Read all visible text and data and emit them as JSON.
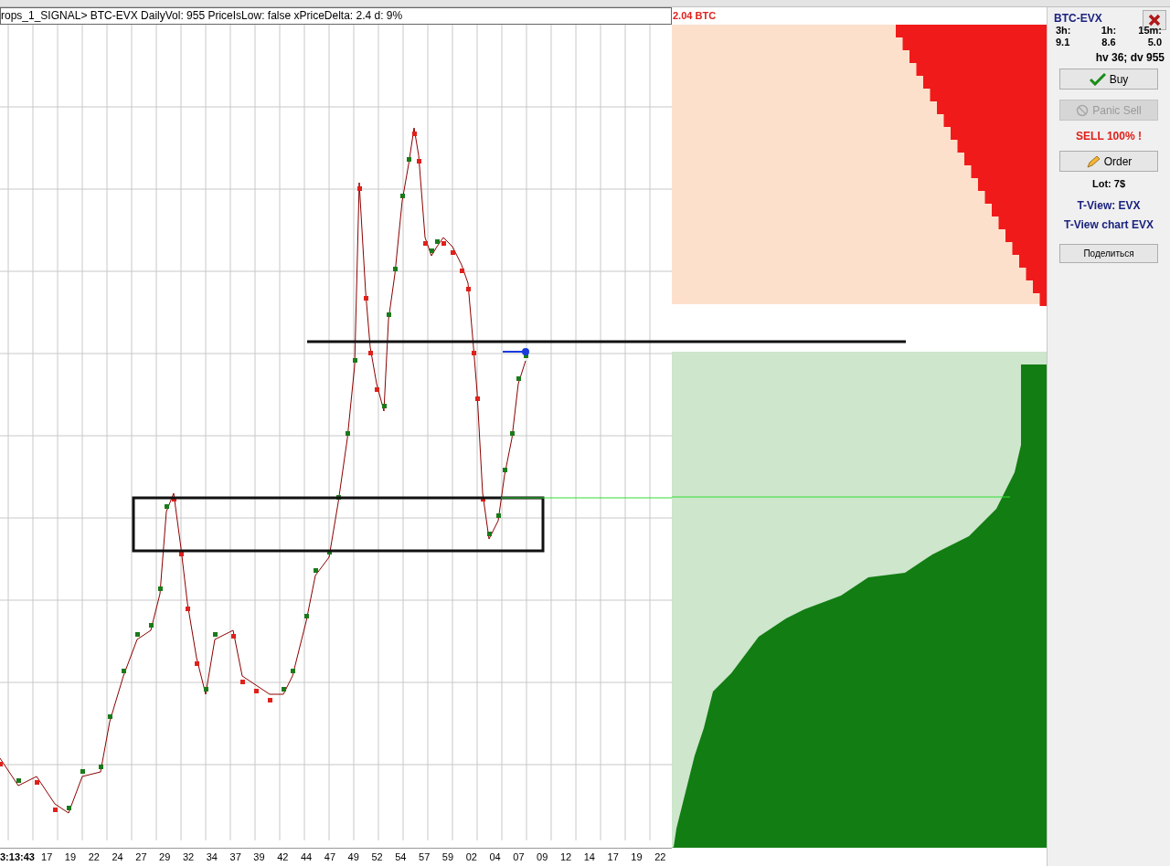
{
  "chart": {
    "title": "rops_1_SIGNAL> BTC-EVX  DailyVol: 955 PriceIsLow: false xPriceDelta: 2.4 d: 9%",
    "x_labels": [
      "3:13:43",
      "17",
      "19",
      "22",
      "24",
      "27",
      "29",
      "32",
      "34",
      "37",
      "39",
      "42",
      "44",
      "47",
      "49",
      "52",
      "54",
      "57",
      "59",
      "02",
      "04",
      "07",
      "09",
      "12",
      "14",
      "17",
      "19",
      "22"
    ]
  },
  "order_book": {
    "total": "2.04 BTC"
  },
  "panel": {
    "pair": "BTC-EVX",
    "stats": [
      {
        "label": "3h:",
        "value": "9.1"
      },
      {
        "label": "1h:",
        "value": "8.6"
      },
      {
        "label": "15m:",
        "value": "5.0"
      }
    ],
    "summary": "hv 36; dv 955",
    "buy_button": {
      "label": "Buy",
      "disabled": false
    },
    "panic_button": {
      "label": "Panic Sell",
      "disabled": true
    },
    "signal": "SELL 100% !",
    "order_button": {
      "label": "Order",
      "disabled": false
    },
    "lot": "Lot: 7$",
    "links": [
      "T-View: EVX",
      "T-View chart EVX"
    ],
    "share_button": {
      "label": "Поделиться"
    }
  }
}
